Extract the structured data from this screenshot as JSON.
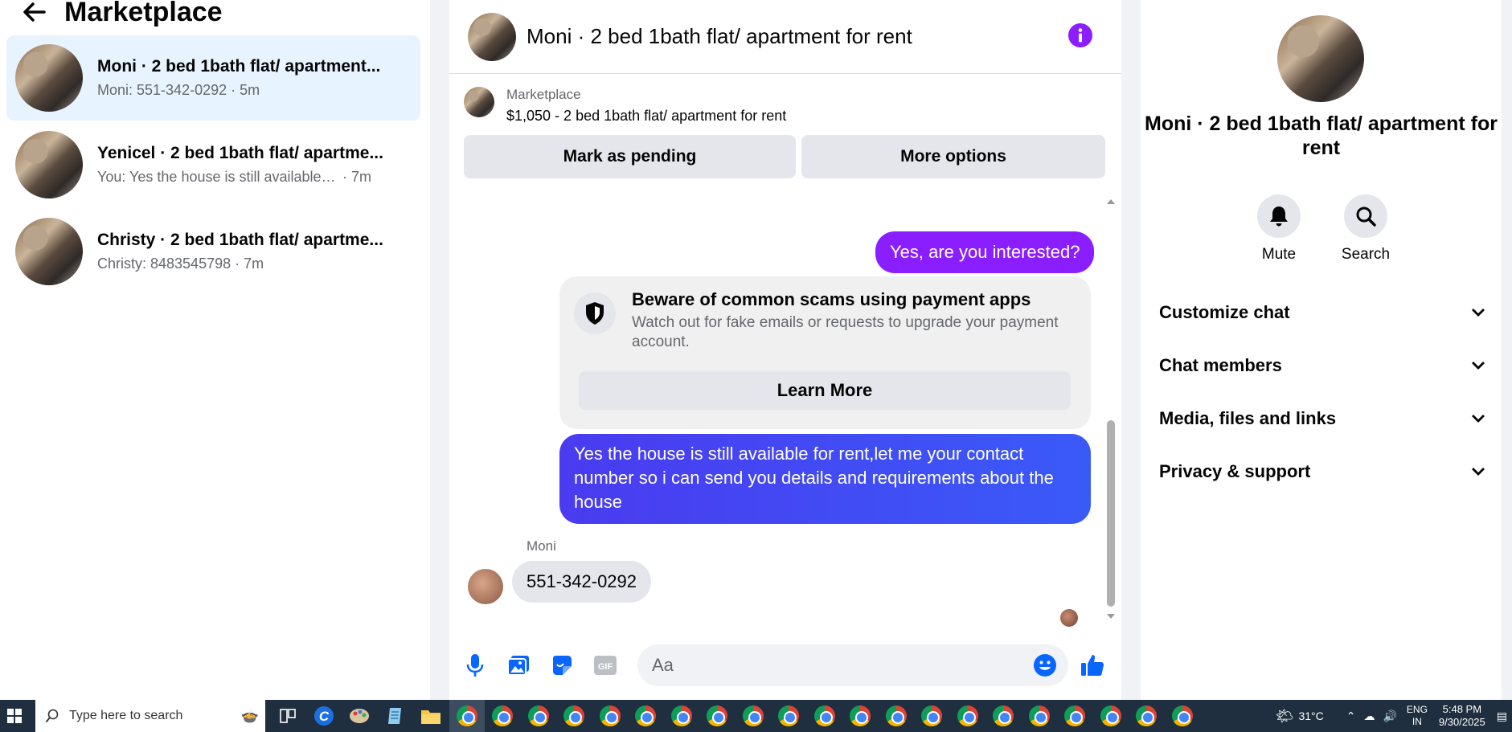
{
  "left_panel": {
    "title": "Marketplace",
    "conversations": [
      {
        "name": "Moni · 2 bed 1bath flat/ apartment...",
        "preview": "Moni: 551-342-0292",
        "time": "5m",
        "active": true
      },
      {
        "name": "Yenicel · 2 bed 1bath flat/ apartme...",
        "preview": "You: Yes the house is still available for...",
        "time": "7m",
        "active": false
      },
      {
        "name": "Christy · 2 bed 1bath flat/ apartme...",
        "preview": "Christy: 8483545798",
        "time": "7m",
        "active": false
      }
    ]
  },
  "chat": {
    "title": "Moni · 2 bed 1bath flat/ apartment for rent",
    "marketplace_label": "Marketplace",
    "listing": "$1,050 - 2 bed 1bath flat/ apartment for rent",
    "mark_pending_label": "Mark as pending",
    "more_options_label": "More options",
    "messages": {
      "out_1": "Yes, are you interested?",
      "warning_title": "Beware of common scams using payment apps",
      "warning_body": "Watch out for fake emails or requests to upgrade your payment account.",
      "learn_more_label": "Learn More",
      "out_2": "Yes the house is still available for rent,let me your contact number so i can send you details and requirements about the house",
      "sender_name": "Moni",
      "in_1": "551-342-0292"
    },
    "composer_placeholder": "Aa"
  },
  "right_panel": {
    "title": "Moni · 2 bed 1bath flat/ apartment for rent",
    "mute_label": "Mute",
    "search_label": "Search",
    "sections": [
      "Customize chat",
      "Chat members",
      "Media, files and links",
      "Privacy & support"
    ]
  },
  "taskbar": {
    "search_placeholder": "Type here to search",
    "weather": "31°C",
    "lang_1": "ENG",
    "lang_2": "IN",
    "time": "5:48 PM",
    "date": "9/30/2025"
  },
  "colors": {
    "accent_purple": "#8a1eff",
    "outgoing_gradient_start": "#4a3bf0",
    "outgoing_gradient_end": "#3a5af8",
    "active_conversation": "#e7f3ff",
    "like_blue": "#0866ff"
  }
}
